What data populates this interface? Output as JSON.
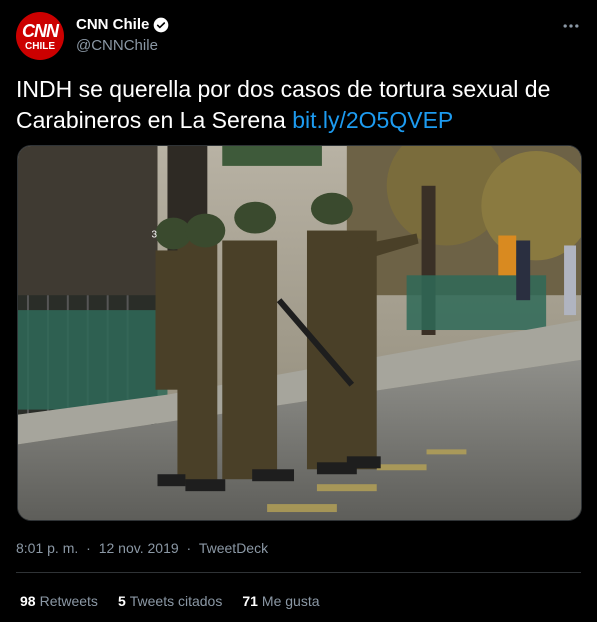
{
  "author": {
    "display_name": "CNN Chile",
    "handle": "@CNNChile",
    "avatar_text_top": "CNN",
    "avatar_text_bottom": "CHILE",
    "avatar_color": "#cc0000",
    "verified": true
  },
  "tweet": {
    "text": "INDH se querella por dos casos de tortura sexual de Carabineros en La Serena",
    "link": "bit.ly/2O5QVEP",
    "link_color": "#1d9bf0"
  },
  "media": {
    "icon": "photo-image",
    "badge_number": "3"
  },
  "meta": {
    "time": "8:01 p. m.",
    "separator": "·",
    "date": "12 nov. 2019",
    "source": "TweetDeck"
  },
  "stats": {
    "retweets_count": "98",
    "retweets_label": "Retweets",
    "quotes_count": "5",
    "quotes_label": "Tweets citados",
    "likes_count": "71",
    "likes_label": "Me gusta"
  }
}
